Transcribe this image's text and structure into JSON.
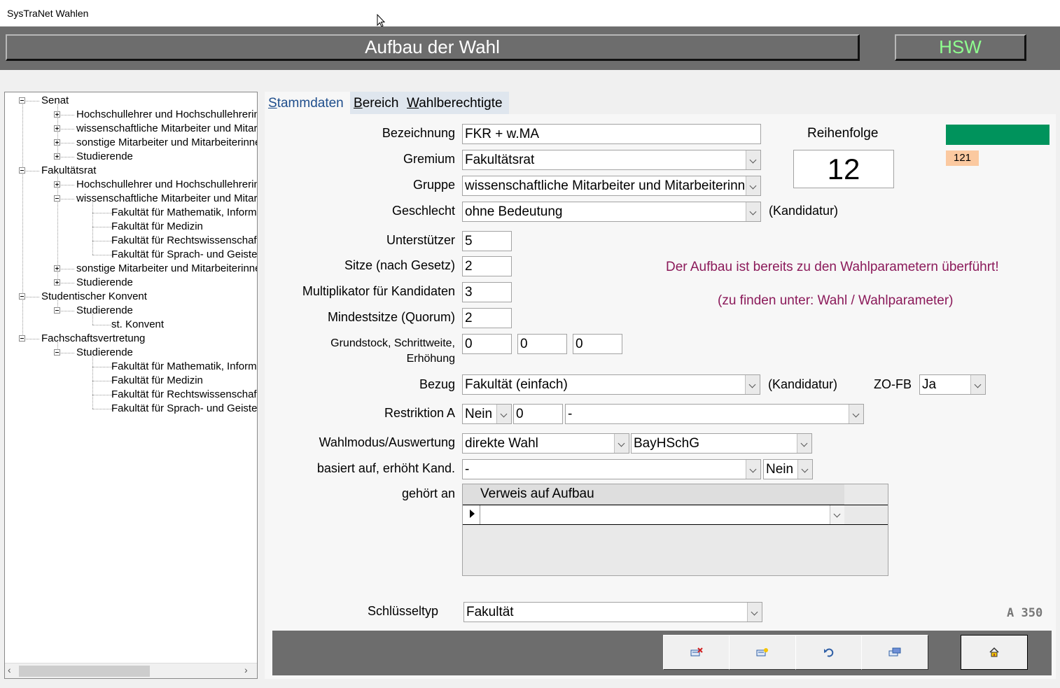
{
  "window": {
    "title": "SysTraNet Wahlen"
  },
  "header": {
    "title": "Aufbau der Wahl",
    "org": "HSW"
  },
  "tree": [
    {
      "label": "Senat",
      "level": 0,
      "box": "minus"
    },
    {
      "label": "Hochschullehrer und Hochschullehrerinnen",
      "level": 1,
      "box": "plus"
    },
    {
      "label": "wissenschaftliche Mitarbeiter und Mitarbeiterinnen",
      "level": 1,
      "box": "plus"
    },
    {
      "label": "sonstige Mitarbeiter und Mitarbeiterinnen",
      "level": 1,
      "box": "plus"
    },
    {
      "label": "Studierende",
      "level": 1,
      "box": "plus"
    },
    {
      "label": "Fakultätsrat",
      "level": 0,
      "box": "minus"
    },
    {
      "label": "Hochschullehrer und Hochschullehrerinnen",
      "level": 1,
      "box": "plus"
    },
    {
      "label": "wissenschaftliche Mitarbeiter und Mitarbeiterinnen",
      "level": 1,
      "box": "minus"
    },
    {
      "label": "Fakultät für Mathematik, Informatik",
      "level": 2,
      "box": "none"
    },
    {
      "label": "Fakultät für Medizin",
      "level": 2,
      "box": "none"
    },
    {
      "label": "Fakultät für Rechtswissenschaft",
      "level": 2,
      "box": "none"
    },
    {
      "label": "Fakultät für Sprach- und Geisteswissenschaften",
      "level": 2,
      "box": "none"
    },
    {
      "label": "sonstige Mitarbeiter und Mitarbeiterinnen",
      "level": 1,
      "box": "plus"
    },
    {
      "label": "Studierende",
      "level": 1,
      "box": "plus"
    },
    {
      "label": "Studentischer Konvent",
      "level": 0,
      "box": "minus"
    },
    {
      "label": "Studierende",
      "level": 1,
      "box": "minus"
    },
    {
      "label": "st. Konvent",
      "level": 2,
      "box": "none"
    },
    {
      "label": "Fachschaftsvertretung",
      "level": 0,
      "box": "minus"
    },
    {
      "label": "Studierende",
      "level": 1,
      "box": "minus"
    },
    {
      "label": "Fakultät für Mathematik, Informatik",
      "level": 2,
      "box": "none"
    },
    {
      "label": "Fakultät für Medizin",
      "level": 2,
      "box": "none"
    },
    {
      "label": "Fakultät für Rechtswissenschaft",
      "level": 2,
      "box": "none"
    },
    {
      "label": "Fakultät für Sprach- und Geisteswissenschaften",
      "level": 2,
      "box": "none"
    }
  ],
  "tabs": {
    "stammdaten": {
      "mnemonic": "S",
      "rest": "tammdaten"
    },
    "bereich": {
      "mnemonic": "B",
      "rest": "ereich"
    },
    "wahlberechtigte": {
      "mnemonic": "W",
      "rest": "ahlberechtigte"
    }
  },
  "form": {
    "bezeichnung": {
      "label": "Bezeichnung",
      "value": "FKR + w.MA"
    },
    "gremium": {
      "label": "Gremium",
      "value": "Fakultätsrat"
    },
    "gruppe": {
      "label": "Gruppe",
      "value": "wissenschaftliche Mitarbeiter und Mitarbeiterinnen"
    },
    "geschlecht": {
      "label": "Geschlecht",
      "value": "ohne Bedeutung",
      "suffix": "(Kandidatur)"
    },
    "unterstuetzer": {
      "label": "Unterstützer",
      "value": "5"
    },
    "sitze": {
      "label": "Sitze (nach Gesetz)",
      "value": "2"
    },
    "multiplikator": {
      "label": "Multiplikator für Kandidaten",
      "value": "3"
    },
    "mindestsitze": {
      "label": "Mindestsitze (Quorum)",
      "value": "2"
    },
    "grundstock": {
      "label_line1": "Grundstock, Schrittweite,",
      "label_line2": "Erhöhung",
      "values": [
        "0",
        "0",
        "0"
      ]
    },
    "bezug": {
      "label": "Bezug",
      "value": "Fakultät (einfach)",
      "suffix": "(Kandidatur)"
    },
    "zofb": {
      "label": "ZO-FB",
      "value": "Ja"
    },
    "restriktion": {
      "label": "Restriktion A",
      "value1": "Nein",
      "value2": "0",
      "value3": "-"
    },
    "wahlmodus": {
      "label": "Wahlmodus/Auswertung",
      "value1": "direkte Wahl",
      "value2": "BayHSchG"
    },
    "basiert": {
      "label": "basiert auf, erhöht Kand.",
      "value1": "-",
      "value2": "Nein"
    },
    "gehoert": {
      "label": "gehört an",
      "column_header": "Verweis auf Aufbau",
      "row_value": ""
    },
    "schluesseltyp": {
      "label": "Schlüsseltyp",
      "value": "Fakultät"
    }
  },
  "reihenfolge": {
    "label": "Reihenfolge",
    "value": "12"
  },
  "status": {
    "badge": "121",
    "color": "#00935c"
  },
  "messages": {
    "line1": "Der Aufbau ist bereits zu den Wahlparametern überführt!",
    "line2": "(zu finden unter: Wahl / Wahlparameter)"
  },
  "form_code": "A 350",
  "footer_buttons": [
    "delete-record-icon",
    "new-record-icon",
    "undo-icon",
    "save-record-icon",
    "home-icon"
  ]
}
